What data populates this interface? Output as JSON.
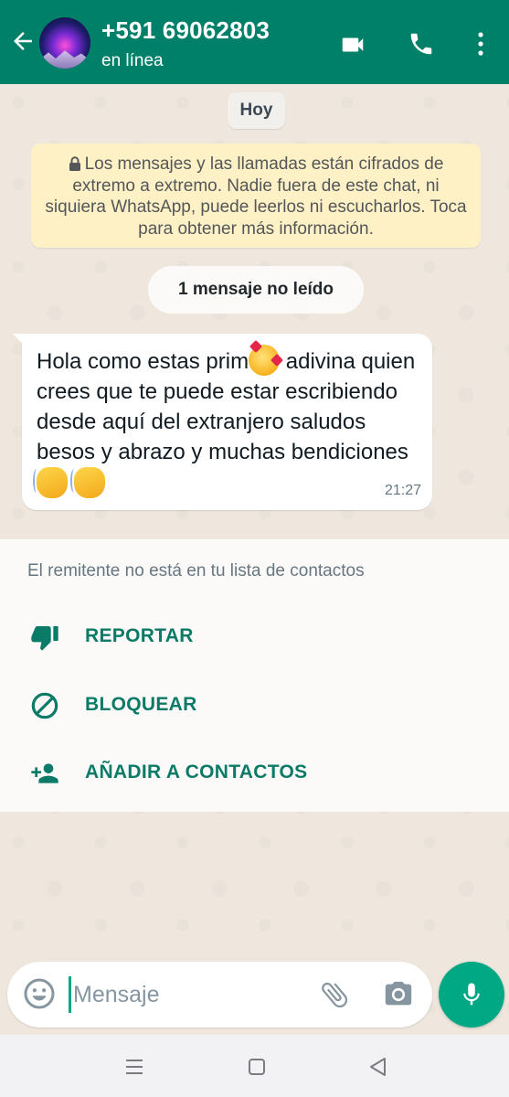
{
  "header": {
    "title": "+591 69062803",
    "status": "en línea",
    "icons": [
      "arrow-back-icon",
      "avatar",
      "video-call-icon",
      "phone-icon",
      "more-vert-icon"
    ]
  },
  "chat": {
    "date_chip": "Hoy",
    "encryption_notice": "Los mensajes y las llamadas están cifrados de extremo a extremo. Nadie fuera de este chat, ni siquiera WhatsApp, puede leerlos ni escucharlos. Toca para obtener más información.",
    "unread_chip": "1 mensaje no leído",
    "message": {
      "part1": "Hola como estas prim",
      "part2": " adivina quien crees que te puede estar escribiendo desde aquí del extranjero saludos besos y abrazo y muchas bendiciones ",
      "emojis": [
        "smiling-face-with-hearts",
        "waving-hand",
        "waving-hand"
      ],
      "time": "21:27"
    }
  },
  "unknown_sender": {
    "note": "El remitente no está en tu lista de contactos",
    "actions": {
      "report": "REPORTAR",
      "block": "BLOQUEAR",
      "add": "AÑADIR A CONTACTOS"
    }
  },
  "composer": {
    "placeholder": "Mensaje"
  },
  "colors": {
    "header": "#008069",
    "accent": "#00a884",
    "action_text": "#0b7a67",
    "notice_bg": "#fdf1c5"
  }
}
